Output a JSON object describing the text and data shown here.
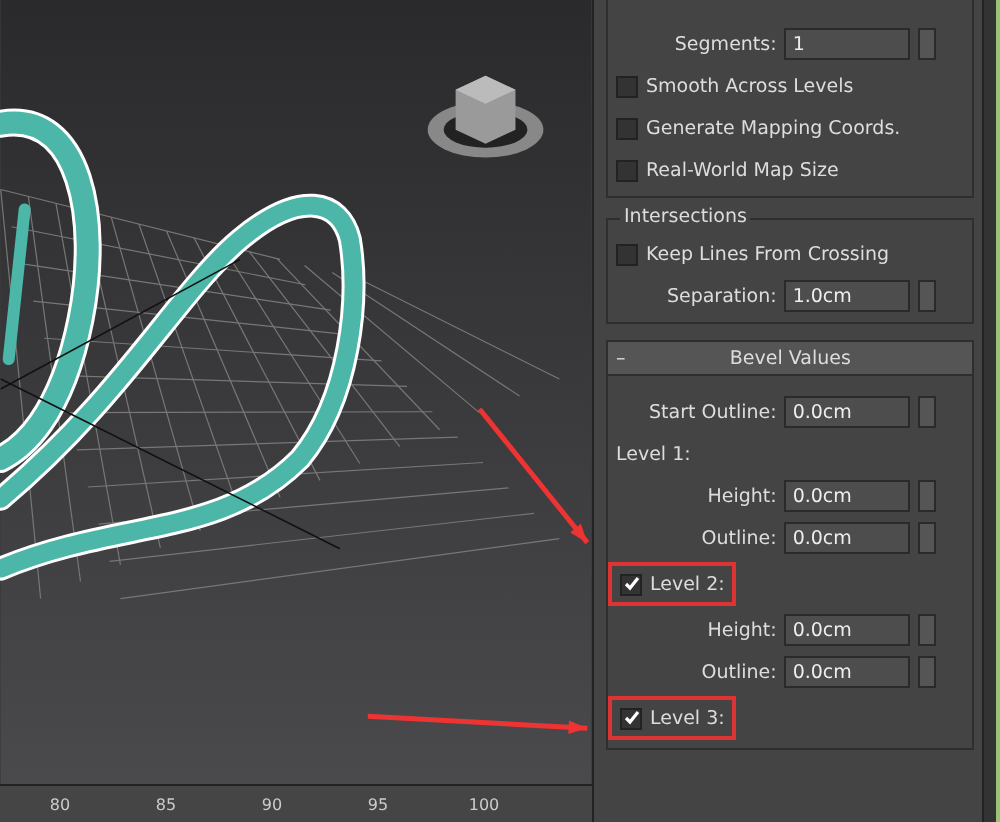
{
  "viewport": {
    "ruler_labels": [
      "80",
      "85",
      "90",
      "95",
      "100"
    ]
  },
  "panel": {
    "segments": {
      "label": "Segments:",
      "value": "1"
    },
    "options": [
      {
        "label": "Smooth Across Levels",
        "checked": false
      },
      {
        "label": "Generate Mapping Coords.",
        "checked": false
      },
      {
        "label": "Real-World Map Size",
        "checked": false
      }
    ],
    "intersections": {
      "title": "Intersections",
      "keep_lines": {
        "label": "Keep Lines From Crossing",
        "checked": false
      },
      "separation": {
        "label": "Separation:",
        "value": "1.0cm"
      }
    },
    "bevel": {
      "collapse": "–",
      "title": "Bevel Values",
      "start_outline": {
        "label": "Start Outline:",
        "value": "0.0cm"
      },
      "levels": [
        {
          "kind": "plain",
          "label": "Level 1:",
          "fields": [
            {
              "label": "Height:",
              "value": "0.0cm"
            },
            {
              "label": "Outline:",
              "value": "0.0cm"
            }
          ]
        },
        {
          "kind": "checkbox",
          "label": "Level 2:",
          "checked": true,
          "highlighted": true,
          "fields": [
            {
              "label": "Height:",
              "value": "0.0cm"
            },
            {
              "label": "Outline:",
              "value": "0.0cm"
            }
          ]
        },
        {
          "kind": "checkbox",
          "label": "Level 3:",
          "checked": true,
          "highlighted": true
        }
      ]
    }
  }
}
